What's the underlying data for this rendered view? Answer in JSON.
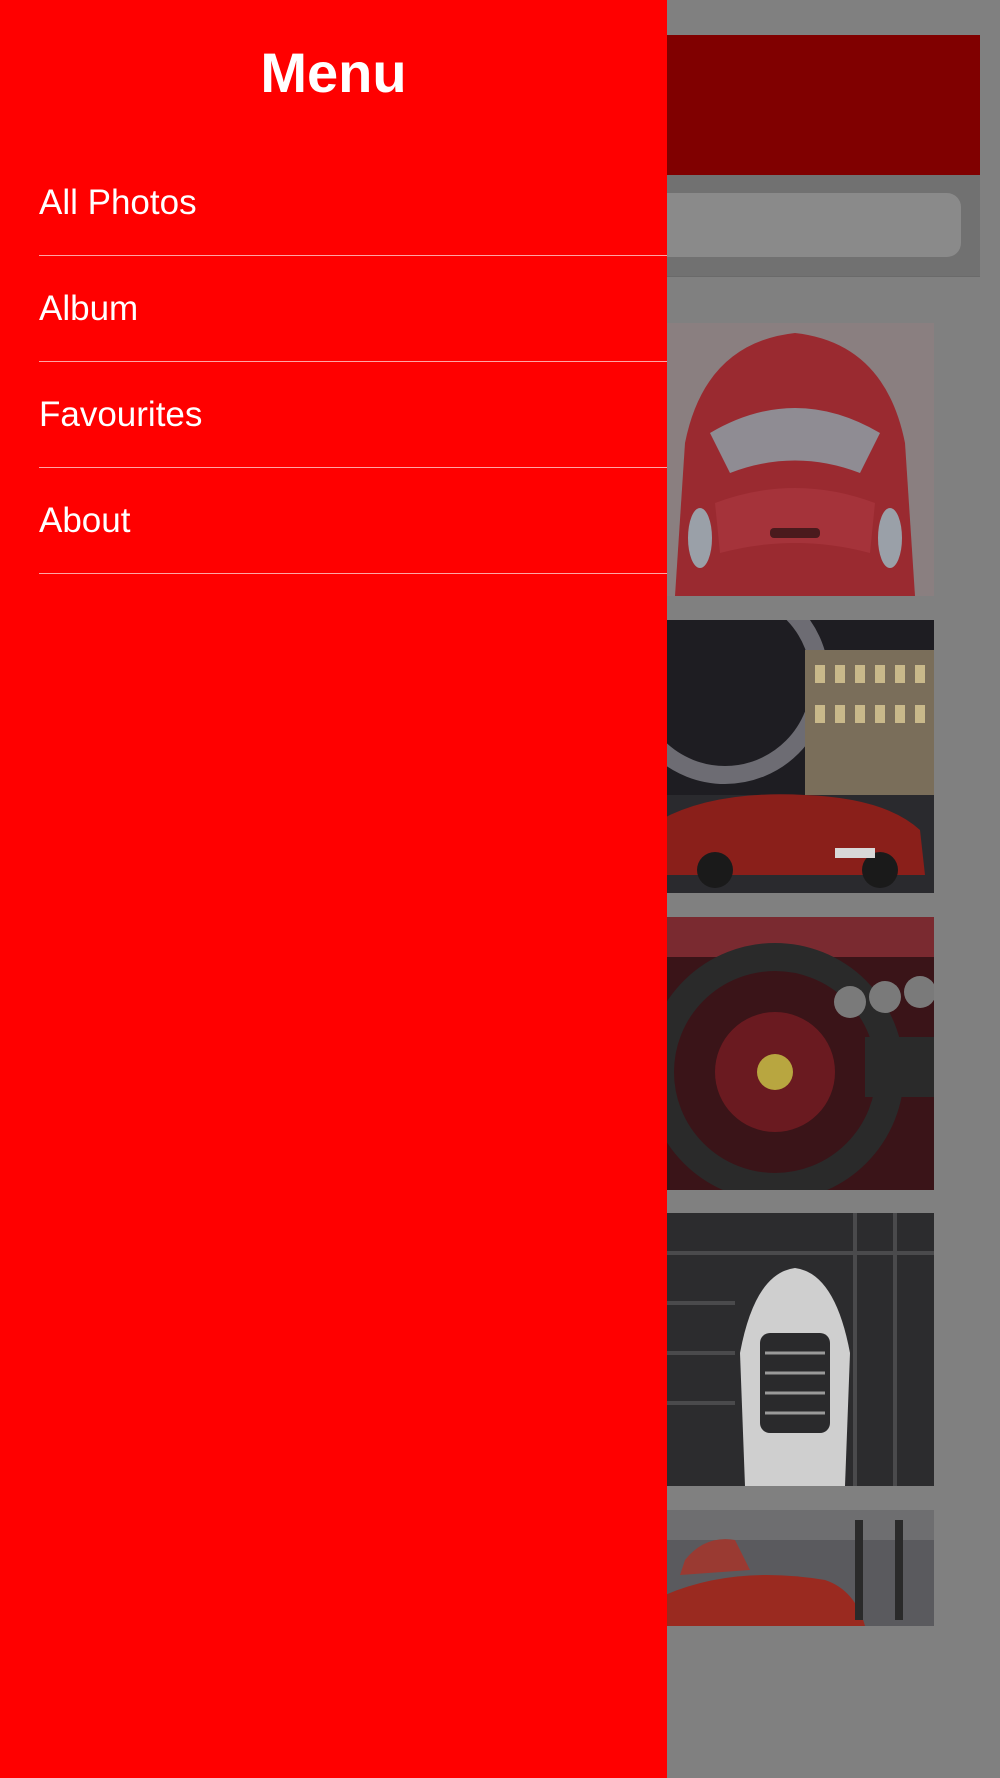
{
  "drawer": {
    "title": "Menu",
    "items": [
      {
        "label": "All Photos"
      },
      {
        "label": "Album"
      },
      {
        "label": "Favourites"
      },
      {
        "label": "About"
      }
    ]
  },
  "colors": {
    "drawer_background": "#ff0000",
    "dimmed_nav_bar": "#800000",
    "overlay": "#808080",
    "text": "#ffffff"
  },
  "photos": [
    {
      "subject": "red sports car front view"
    },
    {
      "subject": "red sports car at night near ferris wheel"
    },
    {
      "subject": "red car interior steering wheel"
    },
    {
      "subject": "white sports car top view in car lift"
    },
    {
      "subject": "red cars on city street"
    }
  ]
}
